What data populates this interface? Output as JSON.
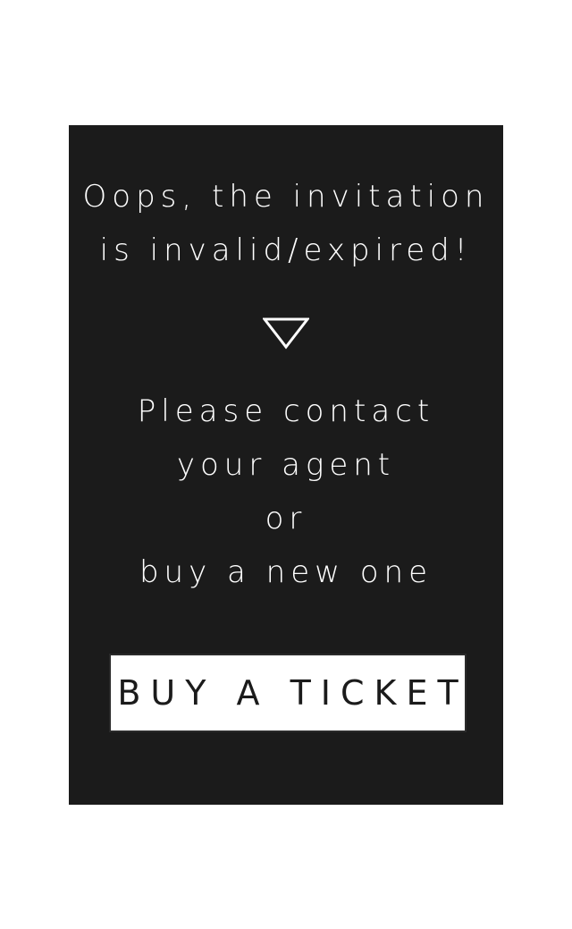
{
  "invalid_invitation": {
    "headline_lines": [
      "Oops, the invitation",
      "is invalid/expired!"
    ],
    "divider_icon": "down-triangle-icon",
    "message_lines": [
      "Please contact",
      "your agent",
      "or",
      "buy a new one"
    ],
    "cta_label": "BUY A TICKET",
    "colors": {
      "page_background": "#ffffff",
      "card_background": "#1b1b1b",
      "text": "#ffffff",
      "button_background": "#ffffff",
      "button_text": "#1b1b1b"
    }
  }
}
